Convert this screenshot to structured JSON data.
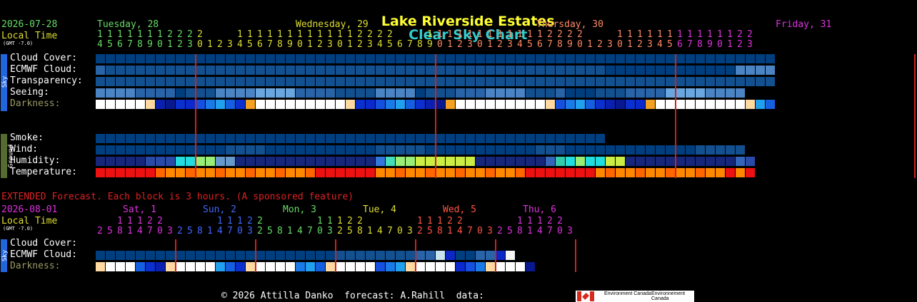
{
  "title_part1": "Lake Riverside Estates",
  "title_part2": "Clear Sky Chart",
  "main": {
    "date": "2026-07-28",
    "local_time": "Local Time",
    "gmt": "(GMT -7.0)",
    "day_labels": [
      {
        "text": "Tuesday, 28",
        "color": "#66dd66"
      },
      {
        "text": "Wednesday, 29",
        "color": "#dddd33"
      },
      {
        "text": "Thursday, 30",
        "color": "#ff8866"
      },
      {
        "text": "Friday, 31",
        "color": "#dd33dd"
      }
    ],
    "hour_tens": "11111112222   1111111111112222   1111111111112222   1111111111112222",
    "hours": "456789012301234567890123012345678901230123456789012301234567890123",
    "sky_label": "Sky",
    "ground_label": "Ground",
    "rows": [
      {
        "label": "Cloud Cover:",
        "cells": "00000000000000000000000000000000000000000000000000000000000000000000"
      },
      {
        "label": "ECMWF Cloud:",
        "cells": "21111111111111111111111111111111111111111111111111100000000000003333"
      },
      {
        "label": "Transparency:",
        "cells": "11111111111111111111111111111111111111111111111111111111111111111111"
      },
      {
        "label": "Seeing:",
        "cells": "33332222011133334444222211113333011122233331112000111222244443333"
      },
      {
        "label": "Darkness:",
        "cells": "WWWWWYBBBBBBBBBOWWWWWWWWWYBBBBBBBBBOWWWWWWWWWYBBBBBBBBBOWWWWWWWWWYBB"
      },
      {
        "label": "Smoke:",
        "cells": "000000000000000000000000000000000000000000000000000"
      },
      {
        "label": "Wind:",
        "cells": "00000000000001111000000000001111100000000000111000000000000011111"
      },
      {
        "label": "Humidity:",
        "cells": "99999777ccgg8899999999999999uwgg44444499999996tcgcc449999999999967"
      },
      {
        "label": "Temperature:",
        "cells": "RRRRRROOOOOOOOOOOOOOOORRRRRROOOOOOOOOOOOOOORRRRRRROOOOOOOOOOOOOROR"
      }
    ]
  },
  "extended": {
    "heading": "EXTENDED Forecast. Each block is 3 hours. (A sponsored feature)",
    "date": "2026-08-01",
    "local_time": "Local Time",
    "gmt": "(GMT -7.0)",
    "day_labels": [
      {
        "text": "Sat, 1",
        "color": "#dd33dd"
      },
      {
        "text": "Sun, 2",
        "color": "#4466ff"
      },
      {
        "text": "Mon, 3",
        "color": "#66dd66"
      },
      {
        "text": "Tue, 4",
        "color": "#dddd33"
      },
      {
        "text": "Wed, 5",
        "color": "#ff5544"
      },
      {
        "text": "Thu, 6",
        "color": "#dd33dd"
      }
    ],
    "hour_tens": "  11122     11122     11122     11122     11122     11122",
    "hours": "258147032581470325814703258147032581470325814703",
    "rows": [
      {
        "label": "Cloud Cover:",
        "cells": ""
      },
      {
        "label": "ECMWF Cloud:",
        "cells": "0000000000000000000000001111111122AB0022BC"
      },
      {
        "label": "Darkness:",
        "cells": "YWWWBBBYWWWWBBBYWWWWBBBYWWWWBBBYWWWWBBBYWWWB"
      }
    ]
  },
  "footer": "© 2026 Attilla Danko  forecast: A.Rahill  data:",
  "logo_text_en": "Environment Canada",
  "logo_text_fr": "Environnement Canada",
  "colors": {
    "label": "#ffffff",
    "darkness_label": "#999966",
    "date": "#66dd66",
    "local_time": "#dddd33",
    "extended_heading": "#dd2222",
    "day_divider": "#cc2222"
  }
}
